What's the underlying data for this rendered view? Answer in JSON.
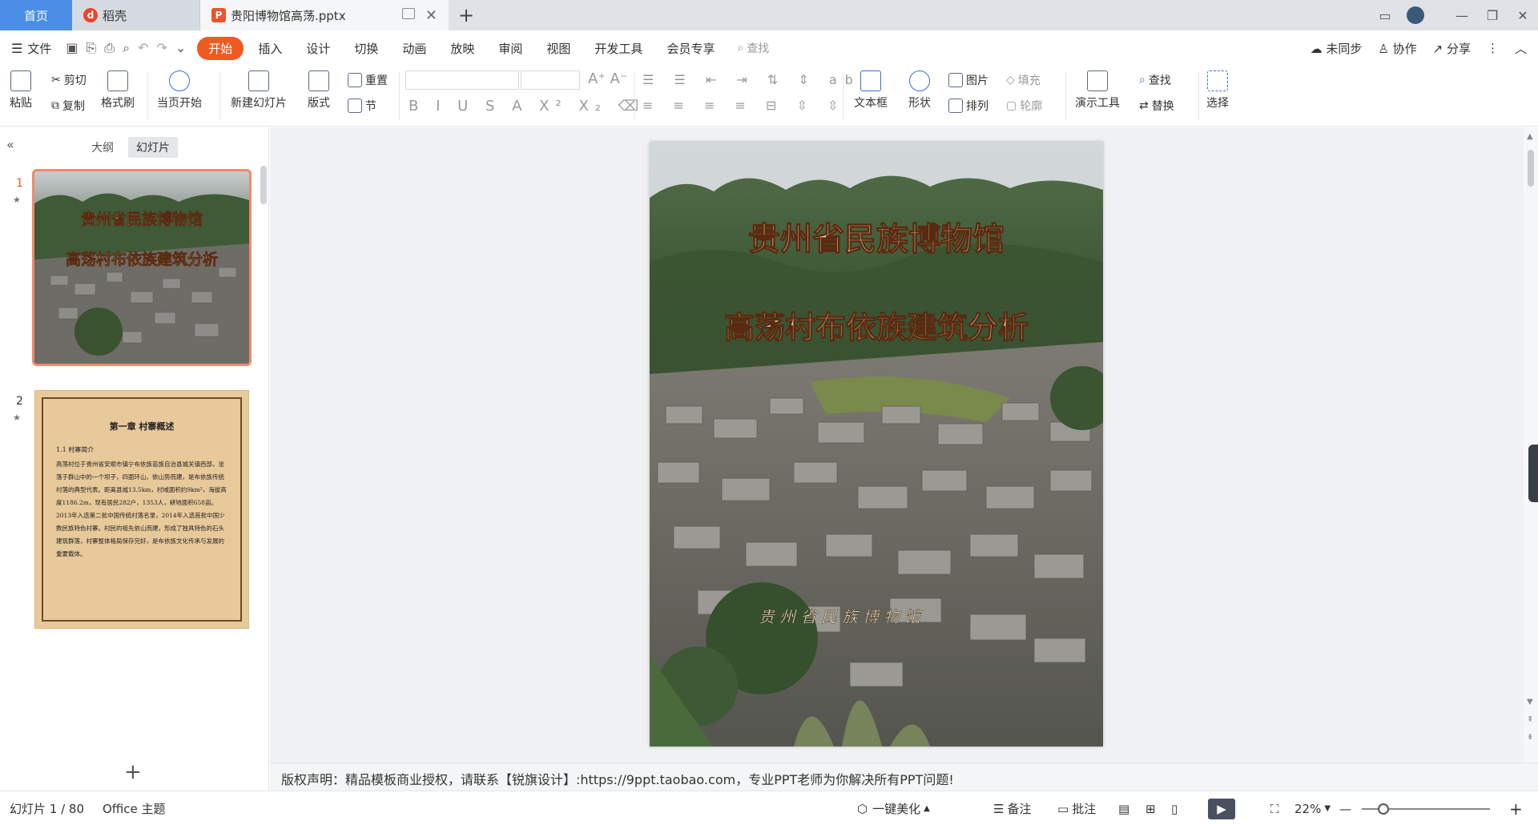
{
  "tabs": {
    "home": "首页",
    "draft": "稻壳",
    "file": "贵阳博物馆高荡.pptx"
  },
  "menu": {
    "file": "文件",
    "items": [
      "开始",
      "插入",
      "设计",
      "切换",
      "动画",
      "放映",
      "审阅",
      "视图",
      "开发工具",
      "会员专享"
    ],
    "search": "查找",
    "sync": "未同步",
    "collab": "协作",
    "share": "分享"
  },
  "ribbon": {
    "paste": "粘贴",
    "cut": "剪切",
    "copy": "复制",
    "format_painter": "格式刷",
    "from_current": "当页开始",
    "new_slide": "新建幻灯片",
    "layout": "版式",
    "section": "节",
    "reset": "重置",
    "textbox": "文本框",
    "shape": "形状",
    "picture": "图片",
    "arrange": "排列",
    "fill": "填充",
    "outline": "轮廓",
    "present_tools": "演示工具",
    "find": "查找",
    "replace": "替换",
    "select": "选择"
  },
  "left_panel": {
    "tab_outline": "大纲",
    "tab_slides": "幻灯片",
    "thumbs": [
      {
        "num": "1",
        "star": "★",
        "line1": "贵州省民族博物馆",
        "line2": "高荡村布依族建筑分析"
      },
      {
        "num": "2",
        "star": "★",
        "heading": "第一章 村寨概述",
        "sub": "1.1 村寨简介",
        "body": "高荡村位于贵州省安顺市镇宁布依族苗族自治县城关镇西部，坐落于群山中的一个坝子，四面环山，依山势而建，是布依族传统村落的典型代表。距离县城13.5km，村域面积约9km²，海拔高度1186.2m，现有居民282户，1353人，耕地面积658亩。2013年入选第二批中国传统村落名录，2014年入选首批中国少数民族特色村寨。村民的祖先依山而建，形成了独具特色的石头建筑群落，村寨整体格局保存完好，是布依族文化传承与发展的重要载体。"
      }
    ]
  },
  "slide": {
    "title1": "贵州省民族博物馆",
    "title2": "高荡村布依族建筑分析",
    "footer": "贵州省民族博物馆"
  },
  "notes": "版权声明：精品模板商业授权，请联系【锐旗设计】:https://9ppt.taobao.com，专业PPT老师为你解决所有PPT问题!",
  "status": {
    "slide_count": "幻灯片 1 / 80",
    "theme": "Office 主题",
    "beautify": "一键美化",
    "notes_btn": "备注",
    "comment": "批注",
    "zoom": "22%"
  },
  "colors": {
    "accent": "#f05a22",
    "tab_active": "#4a8ee5"
  }
}
